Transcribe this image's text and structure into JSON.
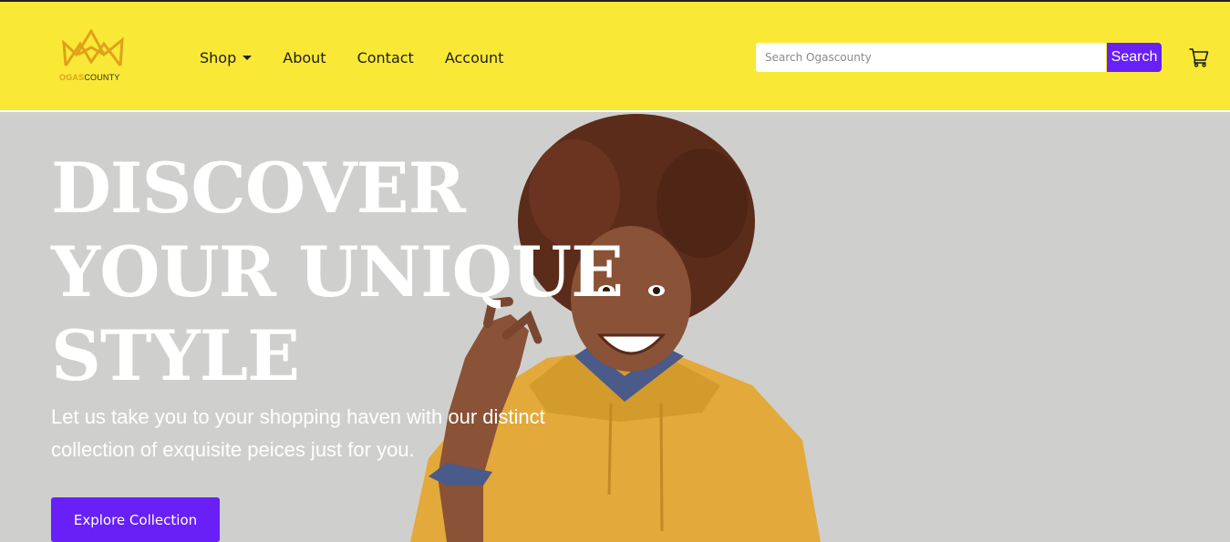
{
  "brand": {
    "logo_text_bold": "OGAS",
    "logo_text_regular": "COUNTY",
    "logo_icon": "crown-icon",
    "accent_color": "#e0a11b"
  },
  "header": {
    "background": "#f9e936",
    "nav": [
      {
        "label": "Shop",
        "has_dropdown": true
      },
      {
        "label": "About"
      },
      {
        "label": "Contact"
      },
      {
        "label": "Account"
      }
    ],
    "search": {
      "placeholder": "Search Ogascounty",
      "value": "",
      "button_label": "Search",
      "button_color": "#6820f7"
    },
    "cart_icon": "cart-icon"
  },
  "hero": {
    "background": "#cfd0ce",
    "headline_lines": [
      "DISCOVER",
      "YOUR UNIQUE",
      "STYLE"
    ],
    "subtext": "Let us take you to your shopping haven with our distinct collection of exquisite peices just for you.",
    "cta_label": "Explore Collection",
    "cta_color": "#6820f7"
  }
}
